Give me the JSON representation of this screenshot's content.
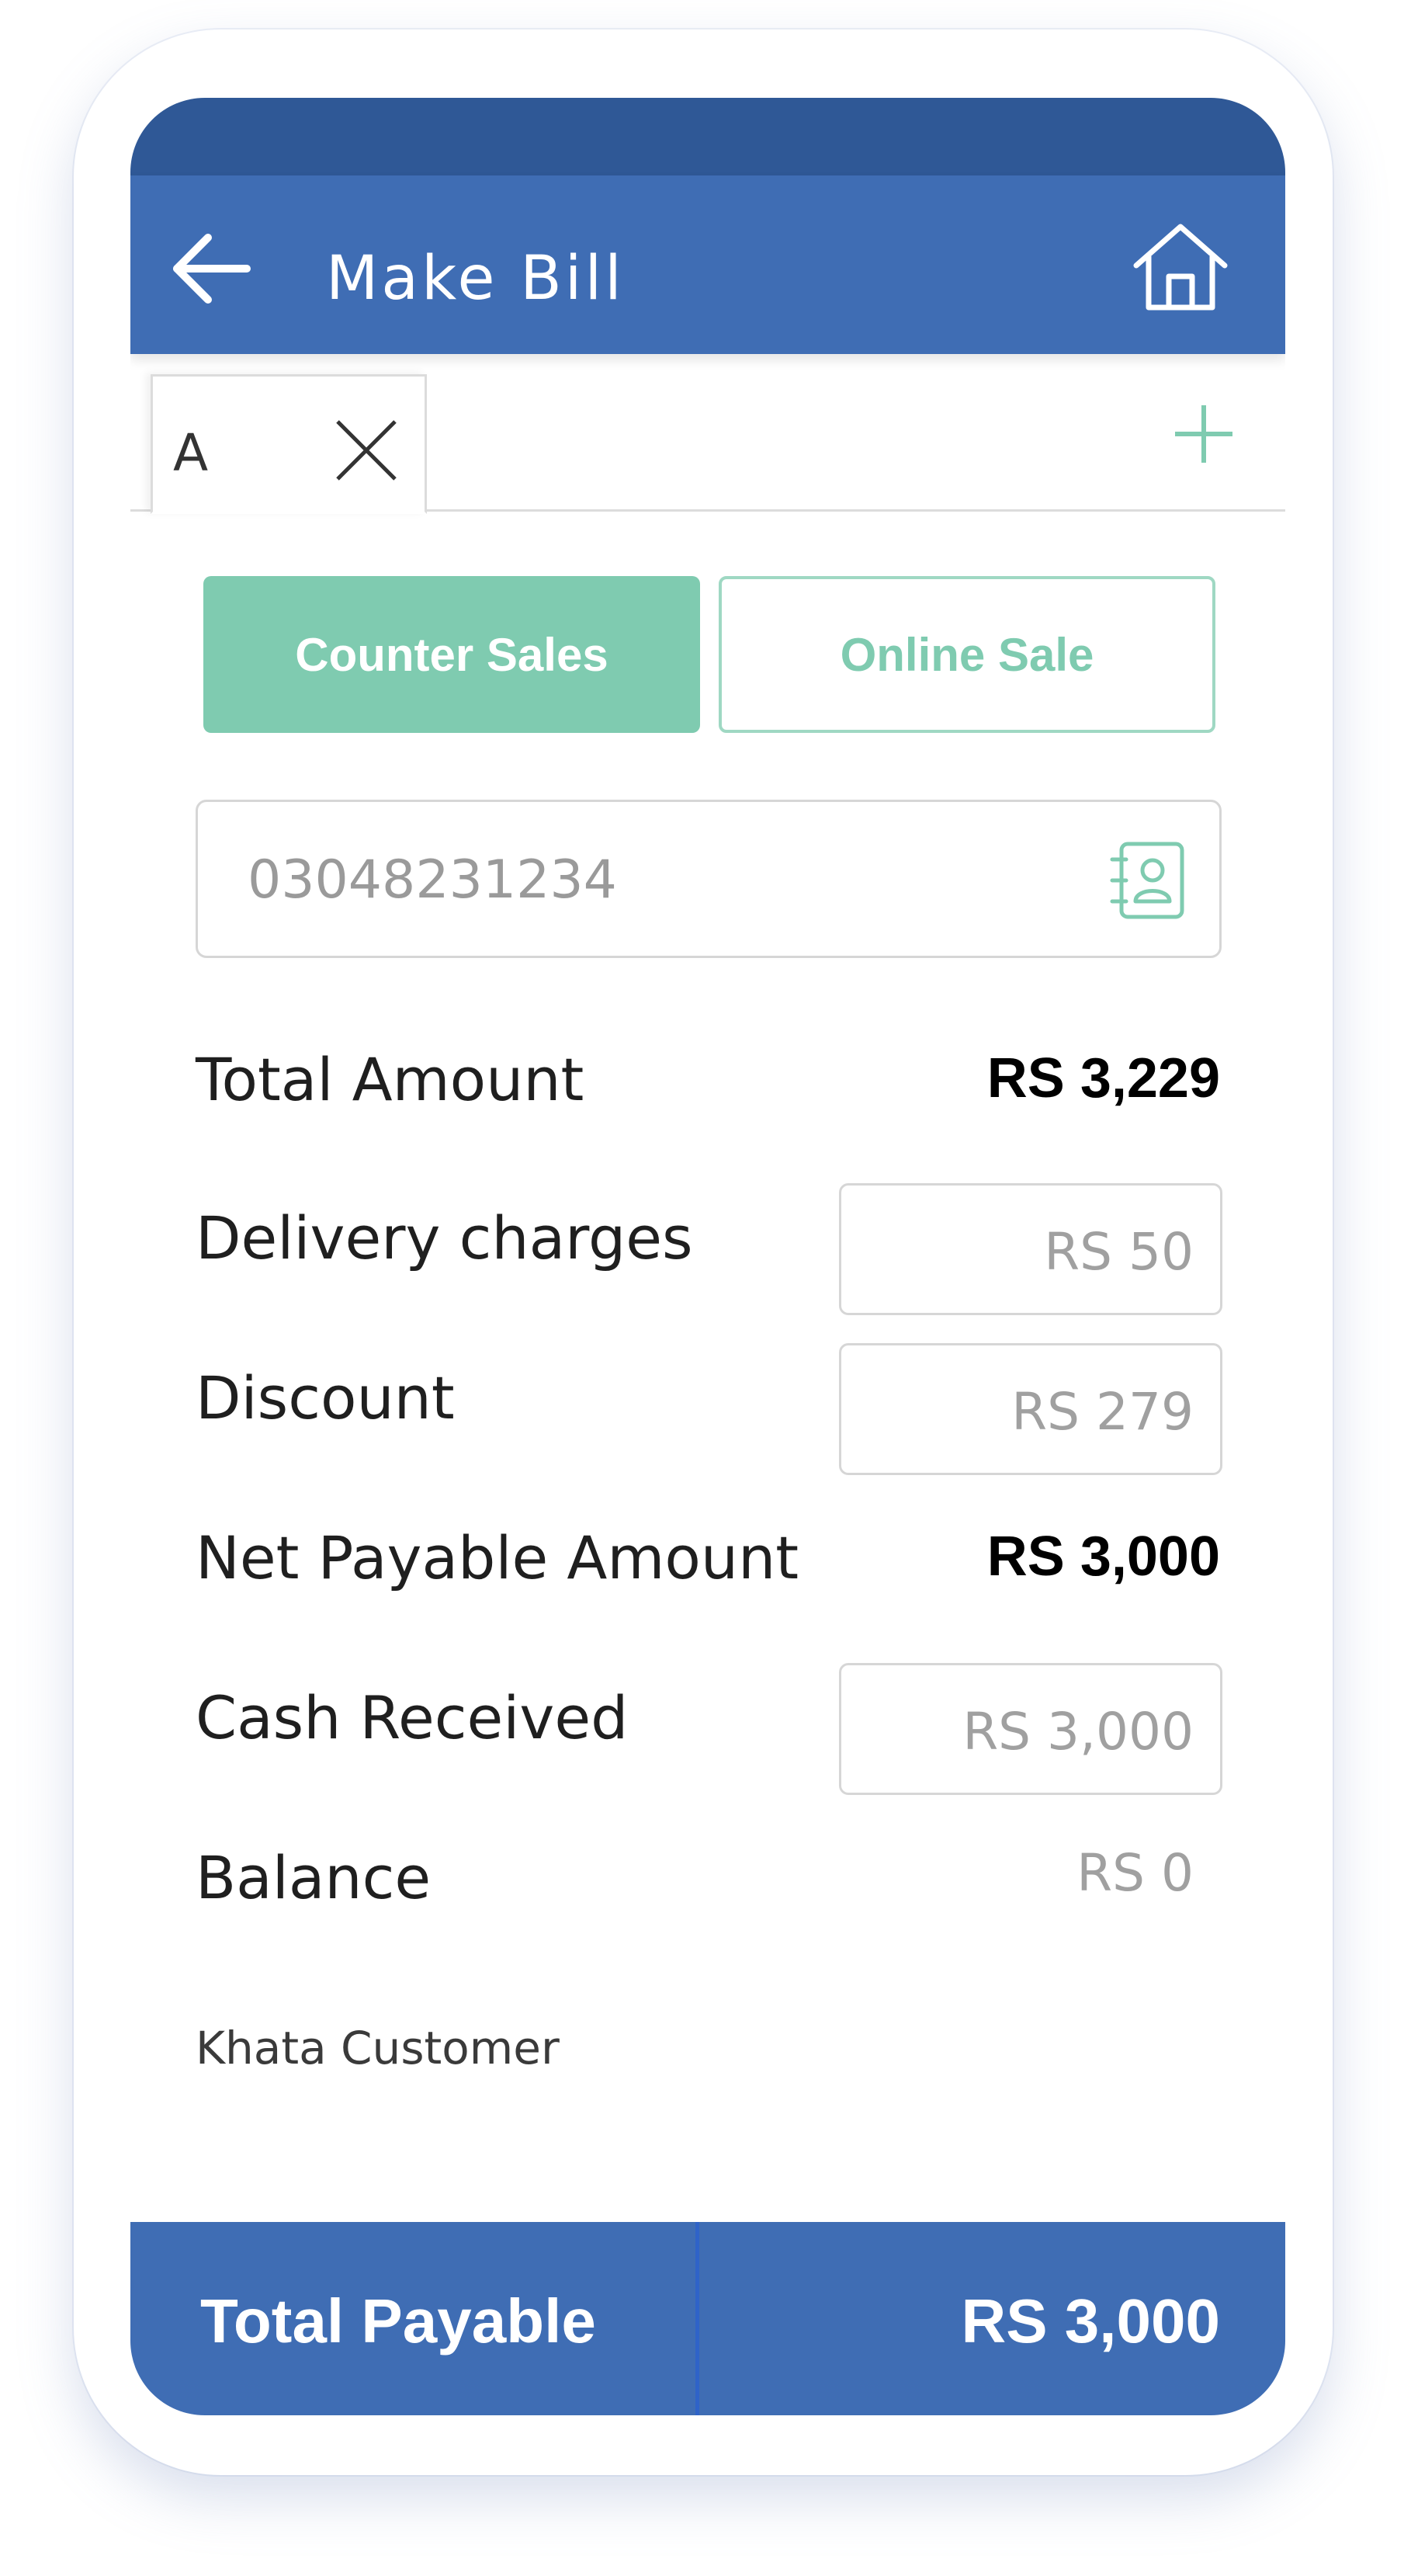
{
  "header": {
    "title": "Make Bill"
  },
  "tabs": {
    "items": [
      {
        "label": "A"
      }
    ]
  },
  "sale_type": {
    "counter_label": "Counter Sales",
    "online_label": "Online Sale",
    "selected": "Counter Sales"
  },
  "customer": {
    "phone_value": "03048231234"
  },
  "summary": {
    "total_amount_label": "Total Amount",
    "total_amount_value": "RS 3,229",
    "delivery_label": "Delivery charges",
    "delivery_value": "RS 50",
    "discount_label": "Discount",
    "discount_value": "RS 279",
    "net_payable_label": "Net Payable Amount",
    "net_payable_value": "RS 3,000",
    "cash_received_label": "Cash Received",
    "cash_received_value": "RS 3,000",
    "balance_label": "Balance",
    "balance_value": "RS 0",
    "khata_label": "Khata Customer"
  },
  "footer": {
    "label": "Total Payable",
    "amount": "RS 3,000"
  },
  "colors": {
    "primary": "#3f6db4",
    "status_bar": "#2f5896",
    "accent": "#7fcbb0"
  },
  "icons": {
    "back": "arrow-left-icon",
    "home": "home-icon",
    "close_tab": "close-icon",
    "add_tab": "plus-icon",
    "contact": "contact-book-icon"
  }
}
